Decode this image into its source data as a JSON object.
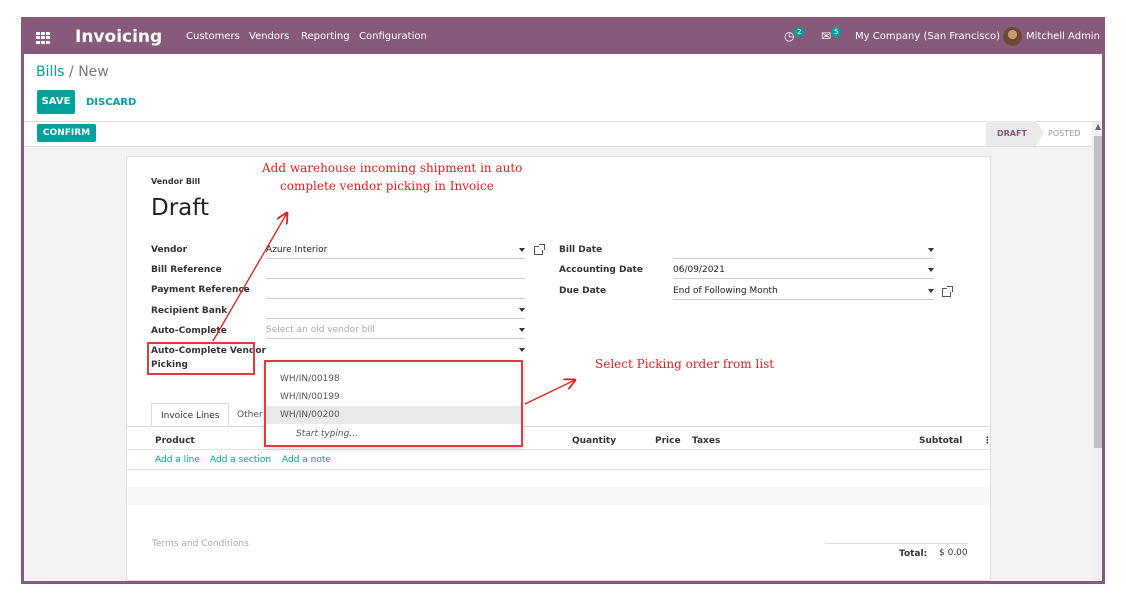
{
  "topbar": {
    "app_title": "Invoicing",
    "menu": [
      "Customers",
      "Vendors",
      "Reporting",
      "Configuration"
    ],
    "activity_badge": "2",
    "messages_badge": "5",
    "company": "My Company (San Francisco)",
    "user": "Mitchell Admin"
  },
  "breadcrumb": {
    "parent": "Bills",
    "separator": "/",
    "current": "New"
  },
  "buttons": {
    "save": "SAVE",
    "discard": "DISCARD",
    "confirm": "CONFIRM"
  },
  "statusbar": {
    "draft": "DRAFT",
    "posted": "POSTED"
  },
  "sheet": {
    "doc_type": "Vendor Bill",
    "state": "Draft",
    "left_fields": {
      "vendor_label": "Vendor",
      "vendor_value": "Azure Interior",
      "bill_ref_label": "Bill Reference",
      "payment_ref_label": "Payment Reference",
      "recipient_bank_label": "Recipient Bank",
      "auto_complete_label": "Auto-Complete",
      "auto_complete_placeholder": "Select an old vendor bill",
      "auto_complete_picking_label_1": "Auto-Complete Vendor",
      "auto_complete_picking_label_2": "Picking"
    },
    "right_fields": {
      "bill_date_label": "Bill Date",
      "accounting_date_label": "Accounting Date",
      "accounting_date_value": "06/09/2021",
      "due_date_label": "Due Date",
      "due_date_value": "End of Following Month"
    },
    "tabs": {
      "invoice_lines": "Invoice Lines",
      "other": "Other"
    },
    "columns": {
      "product": "Product",
      "quantity": "Quantity",
      "price": "Price",
      "taxes": "Taxes",
      "subtotal": "Subtotal"
    },
    "links": {
      "add_line": "Add a line",
      "add_section": "Add a section",
      "add_note": "Add a note"
    },
    "terms": "Terms and Conditions",
    "total_label": "Total:",
    "total_value": "$ 0.00"
  },
  "dropdown": {
    "options": [
      "WH/IN/00198",
      "WH/IN/00199",
      "WH/IN/00200"
    ],
    "start_typing": "Start typing..."
  },
  "annotations": {
    "top_line1": "Add warehouse incoming shipment in auto",
    "top_line2": "complete vendor picking in Invoice",
    "right": "Select Picking order from list"
  },
  "colors": {
    "brand": "#875a7b",
    "accent": "#00a09d",
    "annotation": "#e01e1e"
  }
}
